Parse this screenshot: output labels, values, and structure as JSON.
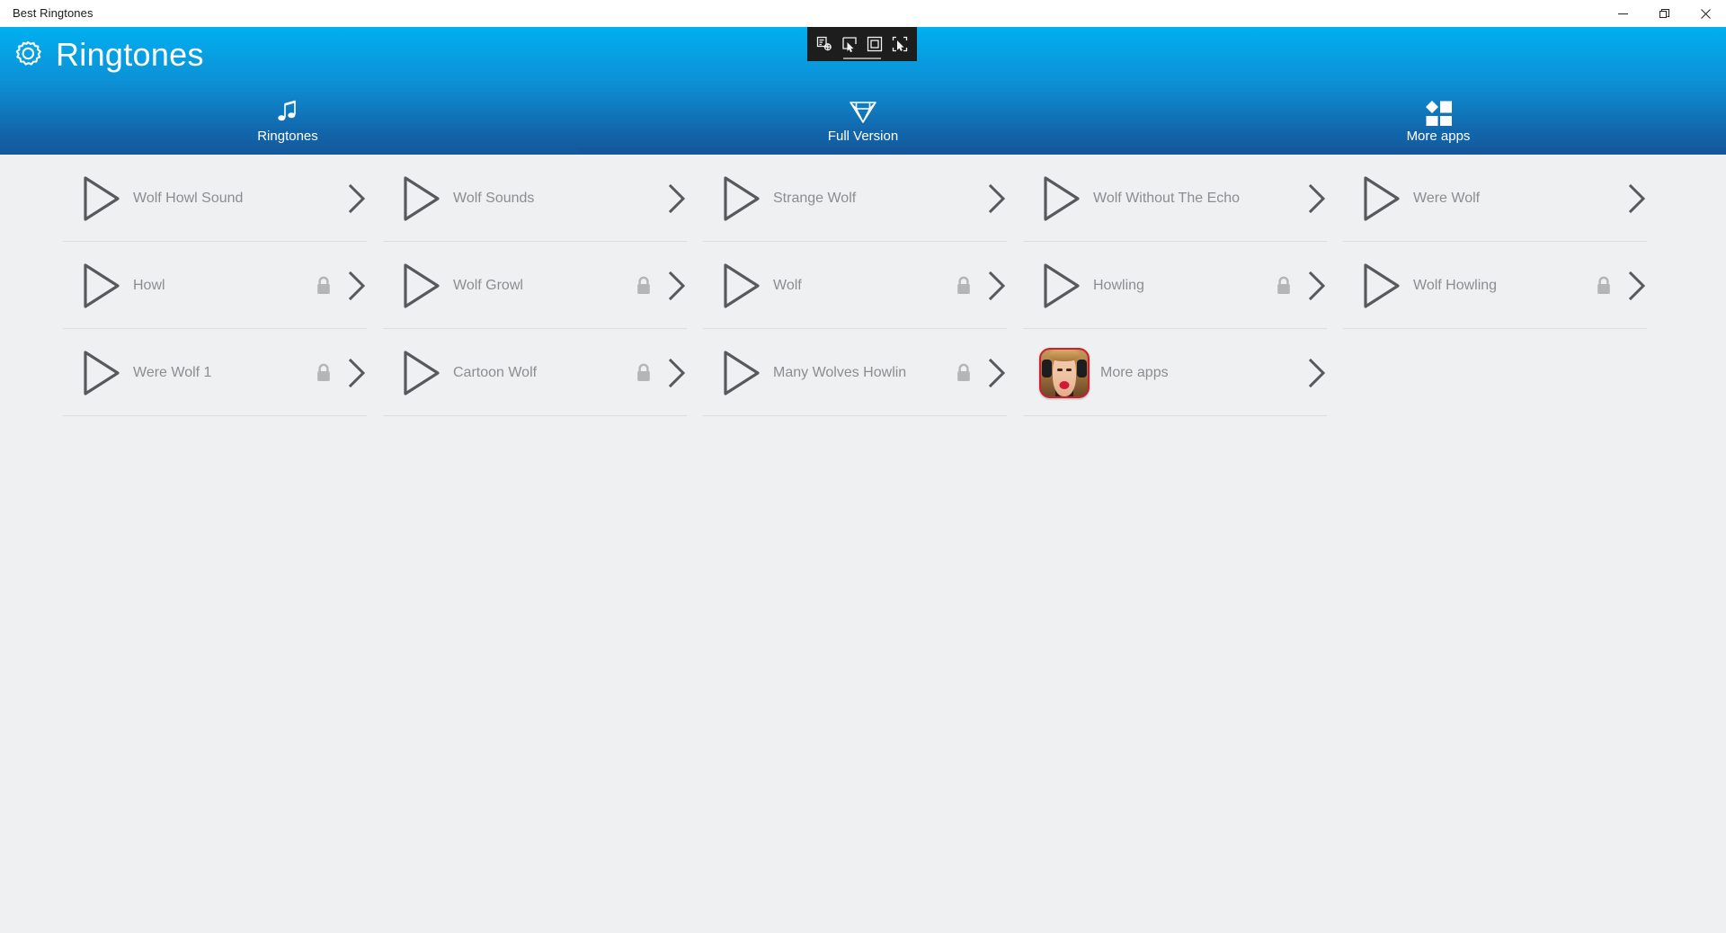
{
  "window": {
    "title": "Best Ringtones",
    "controls": [
      {
        "name": "minimize",
        "glyph": "minimize-icon"
      },
      {
        "name": "maximize",
        "glyph": "restore-icon"
      },
      {
        "name": "close",
        "glyph": "close-icon"
      }
    ]
  },
  "capture_toolbar": {
    "buttons": [
      {
        "name": "capture-region-settings",
        "icon": "document-capture-icon"
      },
      {
        "name": "capture-pointer",
        "icon": "cursor-window-icon"
      },
      {
        "name": "capture-window",
        "icon": "square-frame-icon"
      },
      {
        "name": "capture-selection",
        "icon": "cursor-selection-icon"
      }
    ]
  },
  "header": {
    "title": "Ringtones",
    "icon": "gear-icon",
    "gradient_top": "#00b0f0",
    "gradient_bottom": "#14589b"
  },
  "tabs": [
    {
      "label": "Ringtones",
      "icon": "music-note-icon",
      "active": true
    },
    {
      "label": "Full Version",
      "icon": "diamond-icon",
      "active": false
    },
    {
      "label": "More apps",
      "icon": "apps-grid-icon",
      "active": false
    }
  ],
  "list": {
    "text_color": "#8b8d90",
    "items": [
      {
        "label": "Wolf Howl Sound",
        "locked": false,
        "icon": "play-icon"
      },
      {
        "label": "Wolf Sounds",
        "locked": false,
        "icon": "play-icon"
      },
      {
        "label": "Strange Wolf",
        "locked": false,
        "icon": "play-icon"
      },
      {
        "label": "Wolf Without The Echo",
        "locked": false,
        "icon": "play-icon"
      },
      {
        "label": "Were Wolf",
        "locked": false,
        "icon": "play-icon"
      },
      {
        "label": "Howl",
        "locked": true,
        "icon": "play-icon"
      },
      {
        "label": "Wolf Growl",
        "locked": true,
        "icon": "play-icon"
      },
      {
        "label": "Wolf",
        "locked": true,
        "icon": "play-icon"
      },
      {
        "label": "Howling",
        "locked": true,
        "icon": "play-icon"
      },
      {
        "label": "Wolf Howling",
        "locked": true,
        "icon": "play-icon"
      },
      {
        "label": "Were Wolf 1",
        "locked": true,
        "icon": "play-icon"
      },
      {
        "label": "Cartoon Wolf",
        "locked": true,
        "icon": "play-icon"
      },
      {
        "label": "Many Wolves Howlin",
        "locked": true,
        "icon": "play-icon"
      },
      {
        "label": "More apps",
        "locked": false,
        "icon": "app-thumbnail"
      }
    ]
  }
}
